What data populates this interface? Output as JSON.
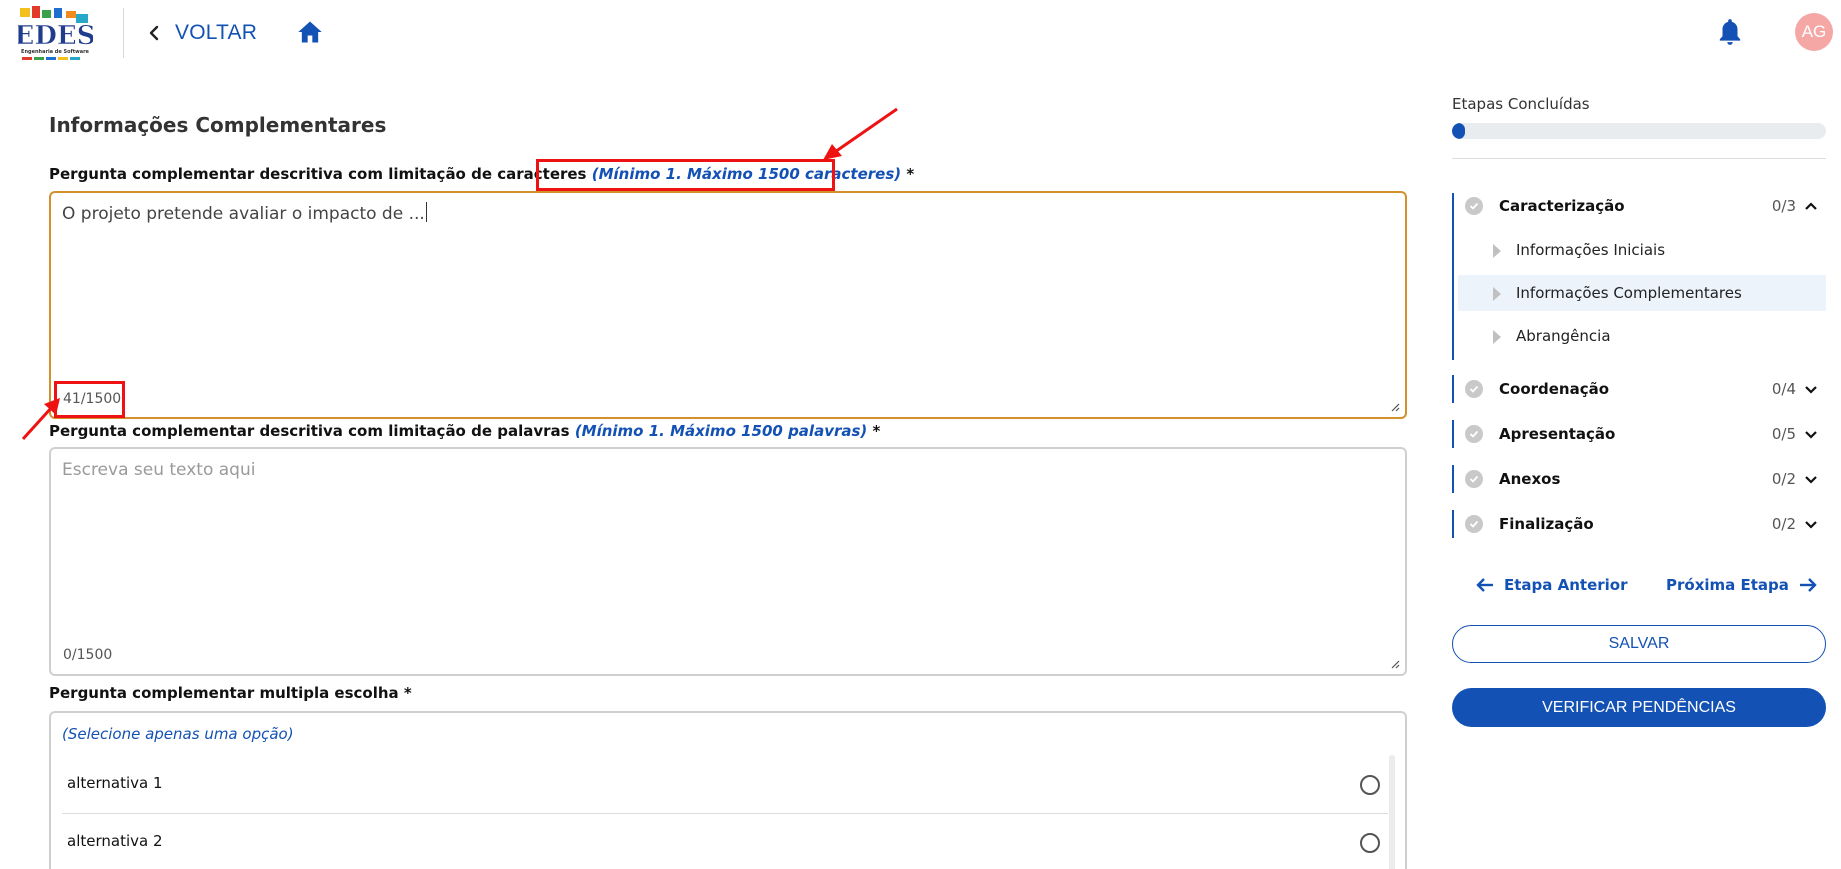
{
  "header": {
    "logo_text": "EDES",
    "logo_subtitle": "Engenharia de Software",
    "back_label": "VOLTAR",
    "avatar_initials": "AG",
    "icons": {
      "back": "chevron-left-icon",
      "home": "home-icon",
      "notifications": "bell-icon"
    }
  },
  "main": {
    "section_title": "Informações Complementares",
    "q1": {
      "label": "Pergunta complementar descritiva com limitação de caracteres",
      "hint": "(Mínimo 1. Máximo 1500 caracteres)",
      "required": "*",
      "value": "O projeto pretende avaliar o impacto de ...",
      "counter": "41/1500"
    },
    "q2": {
      "label": "Pergunta complementar descritiva com limitação de palavras",
      "hint": "(Mínimo 1. Máximo 1500 palavras)",
      "required": "*",
      "placeholder": "Escreva seu texto aqui",
      "counter": "0/1500"
    },
    "q3": {
      "label": "Pergunta complementar multipla escolha",
      "required": "*",
      "hint": "(Selecione apenas uma opção)",
      "options": [
        "alternativa 1",
        "alternativa 2"
      ]
    }
  },
  "sidebar": {
    "title": "Etapas Concluídas",
    "progress_fraction": 0.035,
    "steps": [
      {
        "name": "Caracterização",
        "count": "0/3",
        "expanded": true,
        "substeps": [
          "Informações Iniciais",
          "Informações Complementares",
          "Abrangência"
        ],
        "active_substep": "Informações Complementares"
      },
      {
        "name": "Coordenação",
        "count": "0/4",
        "expanded": false
      },
      {
        "name": "Apresentação",
        "count": "0/5",
        "expanded": false
      },
      {
        "name": "Anexos",
        "count": "0/2",
        "expanded": false
      },
      {
        "name": "Finalização",
        "count": "0/2",
        "expanded": false
      }
    ],
    "prev_label": "Etapa Anterior",
    "next_label": "Próxima Etapa",
    "save_label": "SALVAR",
    "verify_label": "VERIFICAR PENDÊNCIAS"
  },
  "colors": {
    "primary": "#1351b4",
    "focus_border": "#d4902a",
    "annotation": "#ef1212",
    "avatar_bg": "#f5a7a6"
  }
}
